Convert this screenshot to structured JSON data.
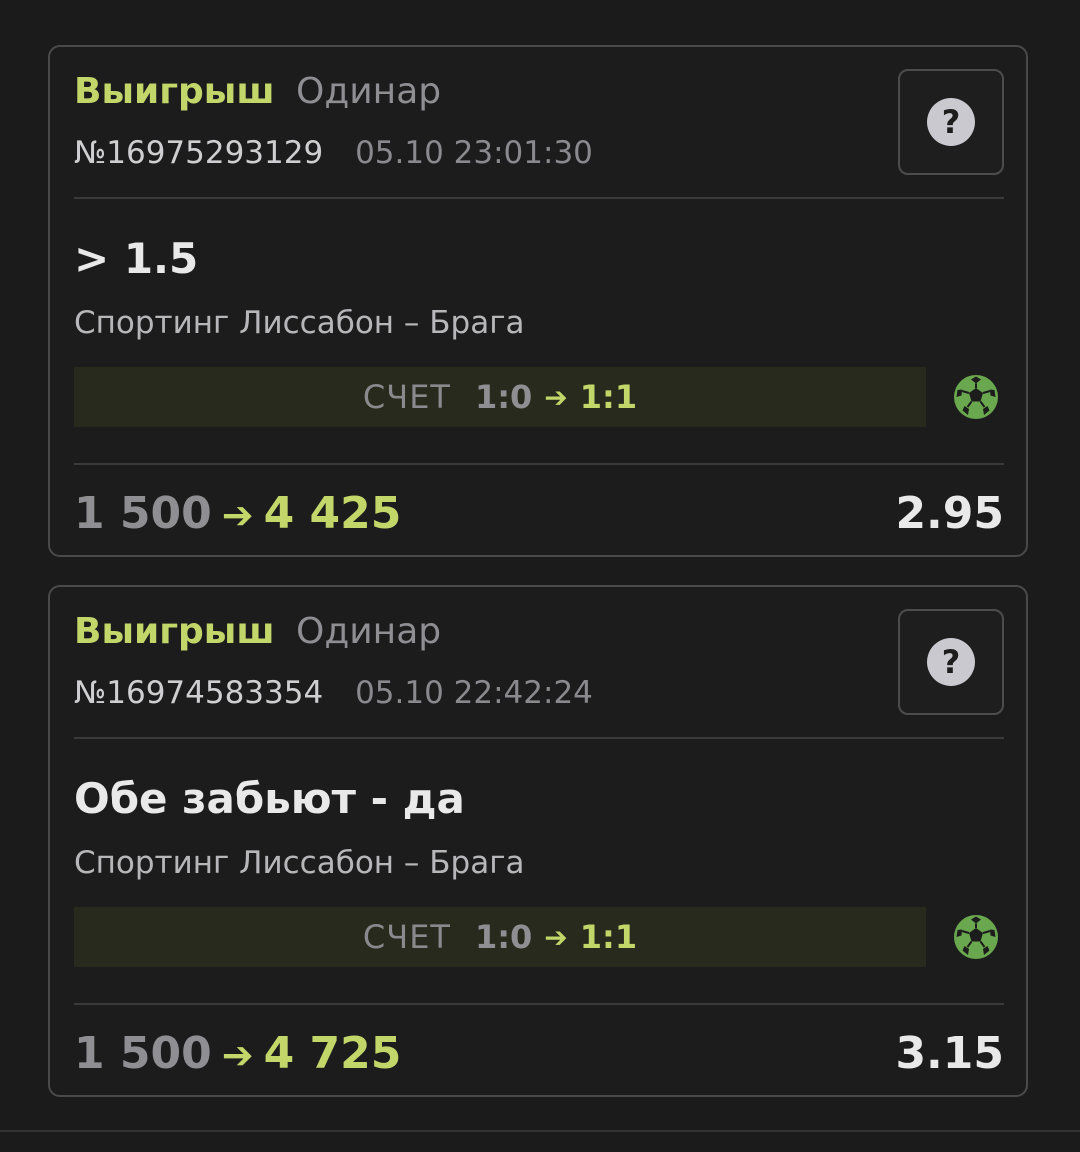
{
  "colors": {
    "background": "#1b1b1b",
    "accent_green": "#c3d66a",
    "muted_gray": "#8f8f93",
    "ball_green": "#6aa84f"
  },
  "bets": [
    {
      "status": "Выигрыш",
      "type": "Одинар",
      "id": "№16975293129",
      "datetime": "05.10 23:01:30",
      "help_icon": "question-icon",
      "market": "> 1.5",
      "teams": "Спортинг Лиссабон – Брага",
      "score_label": "СЧЕТ",
      "score_from": "1:0",
      "score_arrow": "➔",
      "score_to": "1:1",
      "sport_icon": "football-icon",
      "stake": "1 500",
      "amount_arrow": "➔",
      "payout": "4 425",
      "odds": "2.95"
    },
    {
      "status": "Выигрыш",
      "type": "Одинар",
      "id": "№16974583354",
      "datetime": "05.10 22:42:24",
      "help_icon": "question-icon",
      "market": "Обе забьют - да",
      "teams": "Спортинг Лиссабон – Брага",
      "score_label": "СЧЕТ",
      "score_from": "1:0",
      "score_arrow": "➔",
      "score_to": "1:1",
      "sport_icon": "football-icon",
      "stake": "1 500",
      "amount_arrow": "➔",
      "payout": "4 725",
      "odds": "3.15"
    }
  ]
}
